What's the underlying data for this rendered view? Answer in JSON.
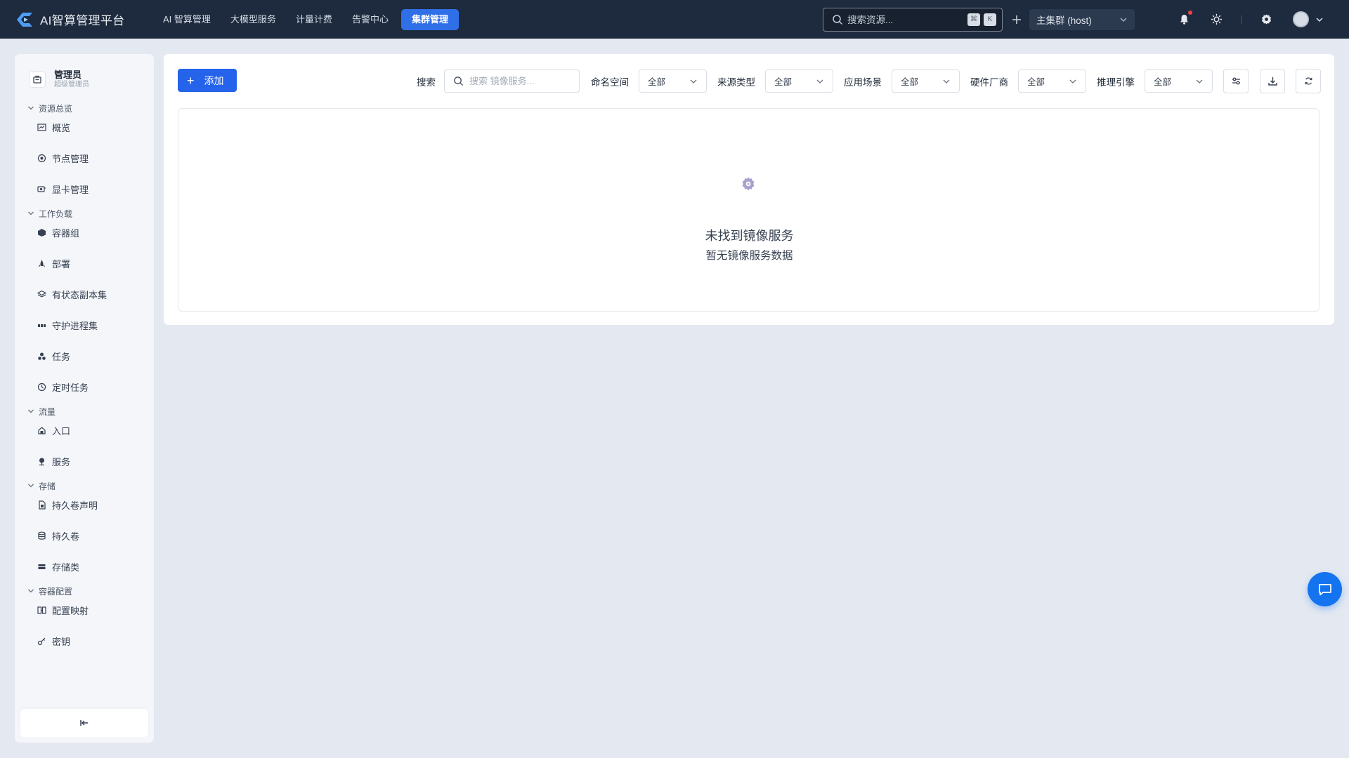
{
  "brand": {
    "title": "AI智算管理平台"
  },
  "topnav": {
    "items": [
      {
        "label": "AI 智算管理"
      },
      {
        "label": "大模型服务"
      },
      {
        "label": "计量计费"
      },
      {
        "label": "告警中心"
      },
      {
        "label": "集群管理"
      }
    ],
    "active_index": 4
  },
  "global_search": {
    "placeholder": "搜索资源...",
    "kbd_1": "⌘",
    "kbd_2": "K"
  },
  "cluster": {
    "selected": "主集群 (host)"
  },
  "user": {
    "name": "管理员",
    "role": "超级管理员"
  },
  "sidebar": {
    "groups": [
      {
        "title": "资源总览",
        "items": [
          "概览",
          "节点管理",
          "显卡管理"
        ]
      },
      {
        "title": "工作负载",
        "items": [
          "容器组",
          "部署",
          "有状态副本集",
          "守护进程集",
          "任务",
          "定时任务"
        ]
      },
      {
        "title": "流量",
        "items": [
          "入口",
          "服务"
        ]
      },
      {
        "title": "存储",
        "items": [
          "持久卷声明",
          "持久卷",
          "存储类"
        ]
      },
      {
        "title": "容器配置",
        "items": [
          "配置映射",
          "密钥"
        ]
      }
    ]
  },
  "toolbar": {
    "add_label": "添加",
    "search_label": "搜索",
    "search_placeholder": "搜索 镜像服务...",
    "filters": [
      {
        "label": "命名空间",
        "value": "全部"
      },
      {
        "label": "来源类型",
        "value": "全部"
      },
      {
        "label": "应用场景",
        "value": "全部"
      },
      {
        "label": "硬件厂商",
        "value": "全部"
      },
      {
        "label": "推理引擎",
        "value": "全部"
      }
    ]
  },
  "empty_state": {
    "title": "未找到镜像服务",
    "description": "暂无镜像服务数据"
  },
  "colors": {
    "accent": "#2563eb",
    "topbar": "#1e2a3d",
    "background": "#e4e9f1",
    "chat_fab": "#1474f0"
  }
}
